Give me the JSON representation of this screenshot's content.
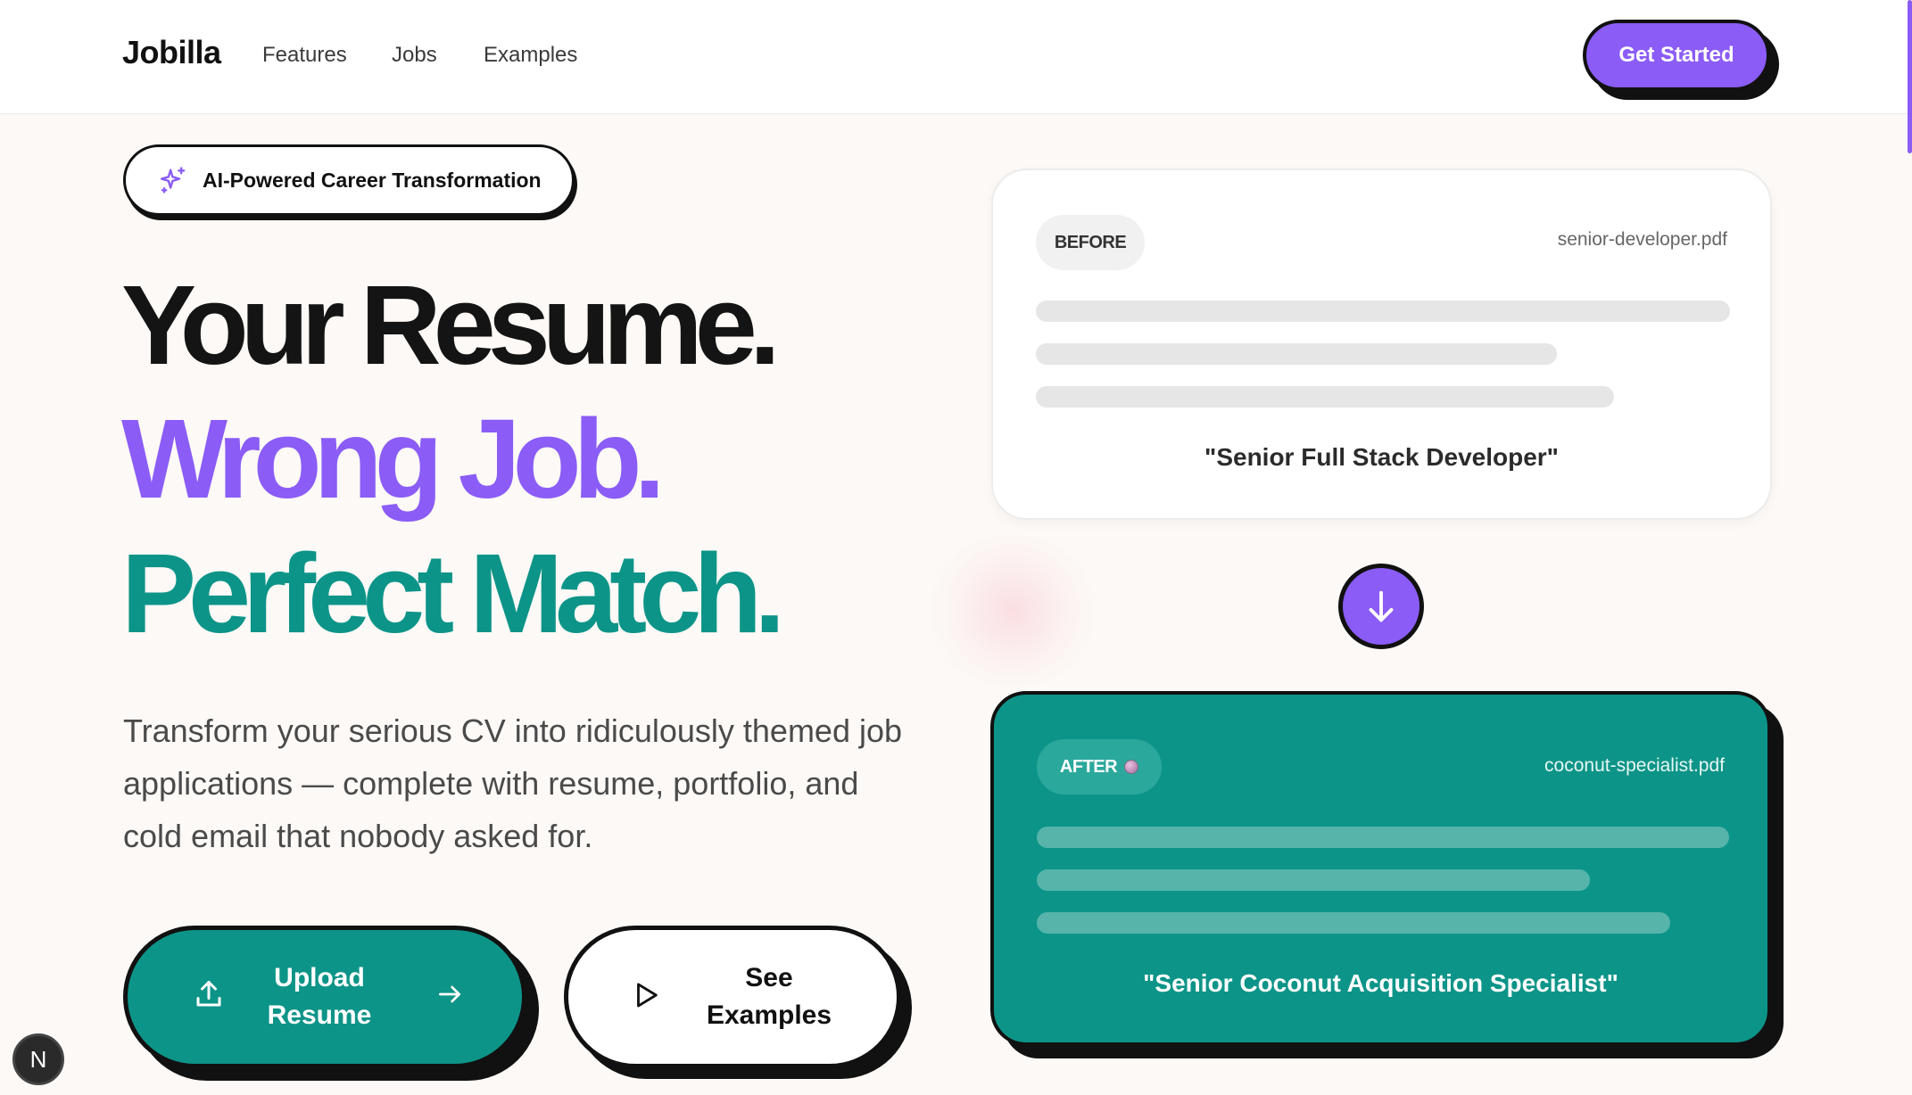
{
  "nav": {
    "logo": "Jobilla",
    "links": [
      "Features",
      "Jobs",
      "Examples"
    ],
    "cta_label": "Get Started"
  },
  "hero": {
    "badge_label": "AI-Powered Career Transformation",
    "headline_1": "Your Resume.",
    "headline_2": "Wrong Job.",
    "headline_3": "Perfect Match.",
    "description": "Transform your serious CV into ridiculously themed job applications — complete with resume, portfolio, and cold email that nobody asked for.",
    "upload_button": {
      "line1": "Upload",
      "line2": "Resume"
    },
    "examples_button": {
      "line1": "See",
      "line2": "Examples"
    }
  },
  "before_card": {
    "pill": "BEFORE",
    "filename": "senior-developer.pdf",
    "title": "\"Senior Full Stack Developer\""
  },
  "after_card": {
    "pill": "AFTER",
    "filename": "coconut-specialist.pdf",
    "title": "\"Senior Coconut Acquisition Specialist\""
  },
  "dev_badge": "N",
  "colors": {
    "accent_purple": "#8b5cf6",
    "accent_teal": "#0d9488",
    "ink": "#111111",
    "background": "#fcf9f6"
  }
}
